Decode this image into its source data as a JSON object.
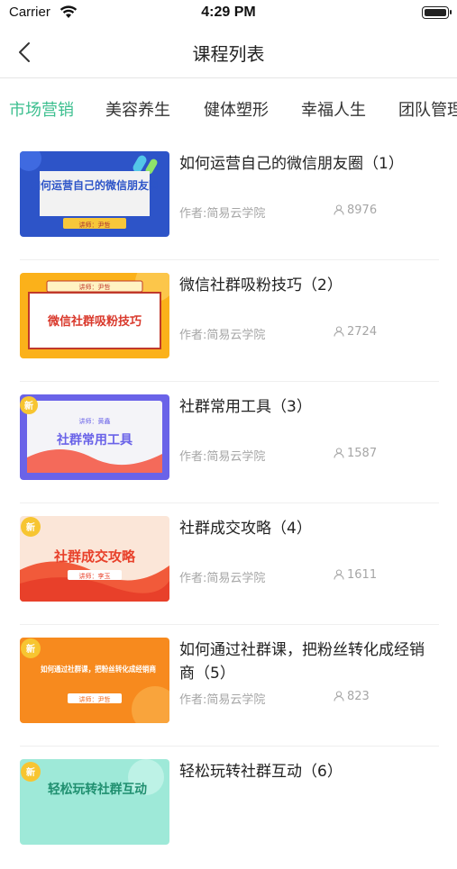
{
  "status_bar": {
    "carrier": "Carrier",
    "time": "4:29 PM"
  },
  "nav": {
    "title": "课程列表"
  },
  "tabs": [
    {
      "label": "市场营销",
      "active": true
    },
    {
      "label": "美容养生"
    },
    {
      "label": "健体塑形"
    },
    {
      "label": "幸福人生"
    },
    {
      "label": "团队管理"
    }
  ],
  "courses": [
    {
      "title": "如何运营自己的微信朋友圈（1）",
      "author": "作者:简易云学院",
      "views": "8976",
      "thumb": {
        "text": "如何运营自己的微信朋友圈",
        "sub": "讲师：尹哲"
      }
    },
    {
      "title": "微信社群吸粉技巧（2）",
      "author": "作者:简易云学院",
      "views": "2724",
      "thumb": {
        "text": "微信社群吸粉技巧",
        "sub": "讲师：尹哲"
      }
    },
    {
      "title": "社群常用工具（3）",
      "author": "作者:简易云学院",
      "views": "1587",
      "thumb": {
        "text": "社群常用工具",
        "sub": "讲师：黄鑫",
        "badge": "新"
      }
    },
    {
      "title": "社群成交攻略（4）",
      "author": "作者:简易云学院",
      "views": "1611",
      "thumb": {
        "text": "社群成交攻略",
        "sub": "讲师：李玉",
        "badge": "新"
      }
    },
    {
      "title": "如何通过社群课，把粉丝转化成经销商（5）",
      "author": "作者:简易云学院",
      "views": "823",
      "thumb": {
        "text": "如何通过社群课，把粉丝转化成经销商",
        "sub": "讲师：尹哲",
        "badge": "新"
      }
    },
    {
      "title": "轻松玩转社群互动（6）",
      "author": "",
      "views": "",
      "thumb": {
        "text": "轻松玩转社群互动",
        "badge": "新"
      }
    }
  ],
  "colors": {
    "accent": "#3cbf8f"
  }
}
